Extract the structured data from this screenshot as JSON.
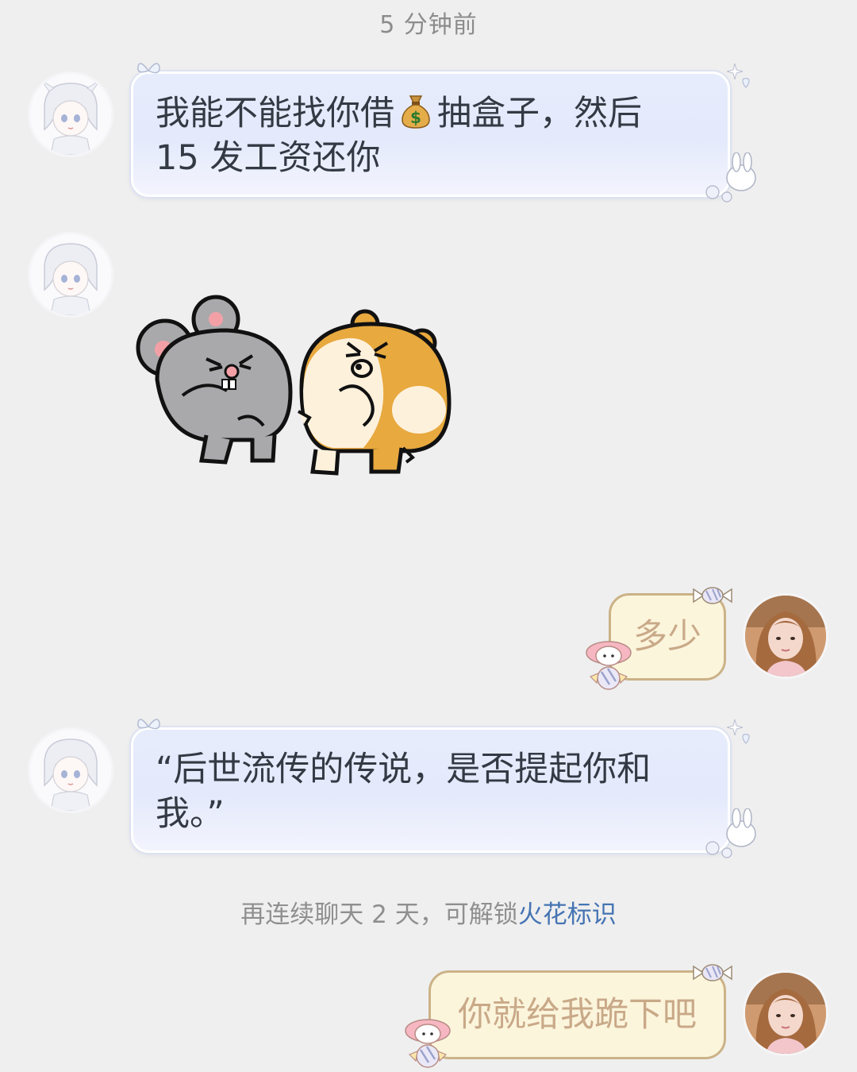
{
  "timestamp": "5 分钟前",
  "messages": [
    {
      "from": "friend",
      "line1_a": "我能不能找你借",
      "emoji": "money-bag",
      "line1_b": "抽盒子，然后",
      "line2": "15 发工资还你"
    },
    {
      "from": "friend",
      "type": "sticker",
      "sticker": "gray-mouse-and-orange-hamster"
    },
    {
      "from": "self",
      "text": "多少"
    },
    {
      "from": "friend",
      "line1": "“后世流传的传说，是否提起你和",
      "line2": "我。”"
    },
    {
      "from": "self",
      "text": "你就给我跪下吧"
    }
  ],
  "notice": {
    "prefix": "再连续聊天 2 天，可解锁",
    "link": "火花标识"
  },
  "colors": {
    "background": "#efefef",
    "friend_bubble": "#e4eafc",
    "self_bubble": "#fbf5dc",
    "self_text": "#c9a988",
    "notice_link": "#4574b3"
  }
}
